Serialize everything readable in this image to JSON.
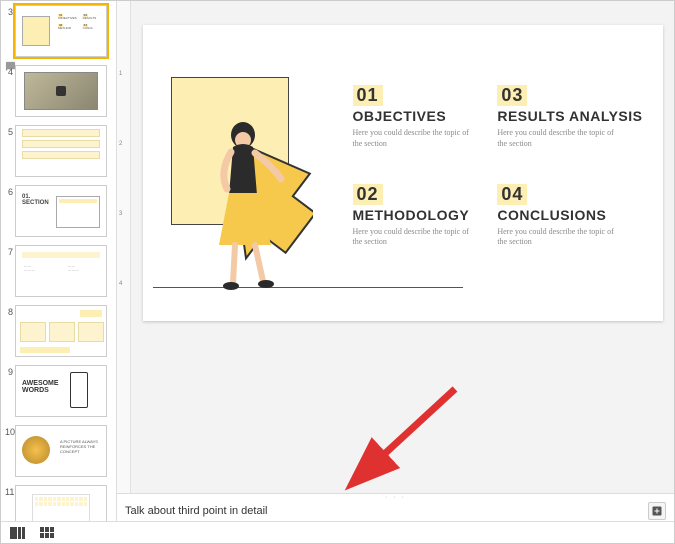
{
  "thumbs": [
    {
      "num": "3"
    },
    {
      "num": "4"
    },
    {
      "num": "5"
    },
    {
      "num": "6"
    },
    {
      "num": "7"
    },
    {
      "num": "8"
    },
    {
      "num": "9"
    },
    {
      "num": "10"
    },
    {
      "num": "11"
    }
  ],
  "thumb9": {
    "title_a": "AWESOME",
    "title_b": "WORDS"
  },
  "thumb10": {
    "caption": "A PICTURE ALWAYS REINFORCES THE CONCEPT"
  },
  "thumb6": {
    "big_a": "01.",
    "big_b": "SECTION"
  },
  "slide": {
    "items": [
      {
        "num": "01",
        "title": "OBJECTIVES",
        "desc": "Here you could describe the topic of the section"
      },
      {
        "num": "03",
        "title": "RESULTS ANALYSIS",
        "desc": "Here you could describe the topic of the section"
      },
      {
        "num": "02",
        "title": "METHODOLOGY",
        "desc": "Here you could describe the topic of the section"
      },
      {
        "num": "04",
        "title": "CONCLUSIONS",
        "desc": "Here you could describe the topic of the section"
      }
    ]
  },
  "notes": {
    "text": "Talk about third point in detail"
  },
  "ruler": {
    "t1": "1",
    "t2": "2",
    "t3": "3",
    "t4": "4"
  }
}
